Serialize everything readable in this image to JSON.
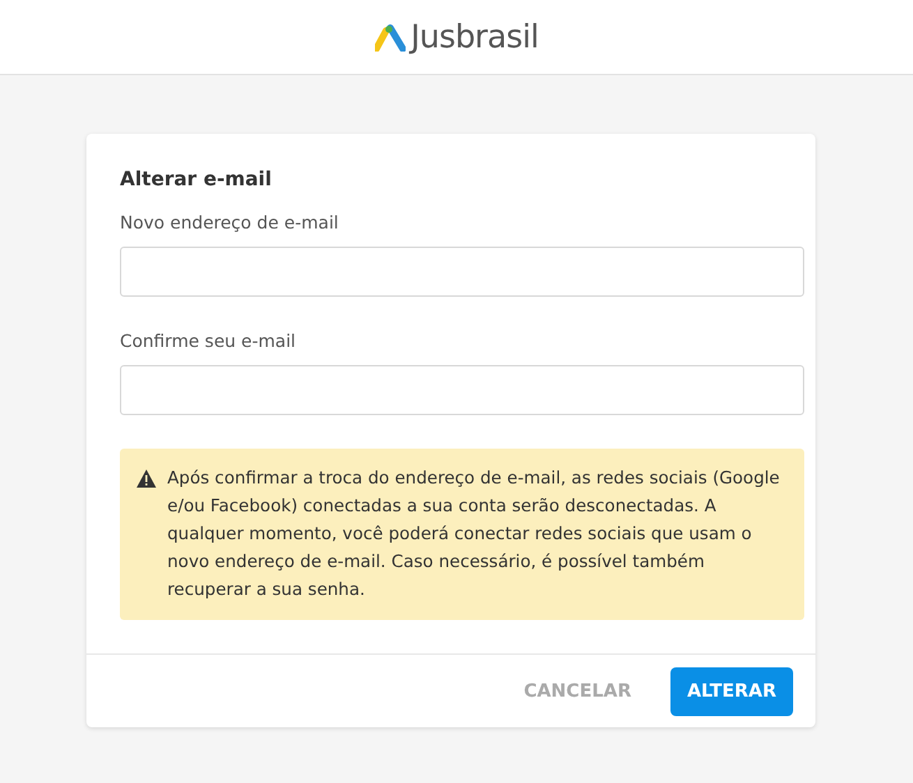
{
  "header": {
    "logo_text": "Jusbrasil"
  },
  "card": {
    "title": "Alterar e-mail",
    "fields": [
      {
        "label": "Novo endereço de e-mail"
      },
      {
        "label": "Confirme seu e-mail"
      }
    ],
    "warning": "Após confirmar a troca do endereço de e-mail, as redes sociais (Google e/ou Facebook) conectadas a sua conta serão desconectadas. A qualquer momento, você poderá conectar redes sociais que usam o novo endereço de e-mail. Caso necessário, é possível também recuperar a sua senha.",
    "buttons": [
      {
        "label": "CANCELAR",
        "kind": "text"
      },
      {
        "label": "ALTERAR",
        "kind": "primary"
      }
    ]
  }
}
